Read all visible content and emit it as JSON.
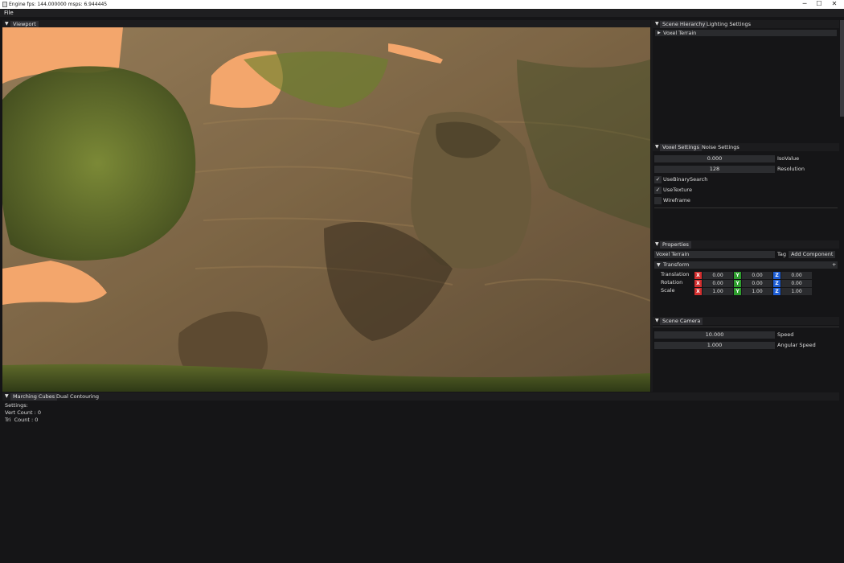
{
  "window": {
    "title": "Engine fps: 144.000000   msps: 6.944445"
  },
  "menubar": {
    "file": "File"
  },
  "viewport": {
    "tab": "Viewport"
  },
  "scene_hierarchy": {
    "tabs": [
      "Scene Hierarchy",
      "Lighting Settings"
    ],
    "items": [
      "Voxel Terrain"
    ]
  },
  "voxel_settings": {
    "tabs": [
      "Voxel Settings",
      "Noise Settings"
    ],
    "isovalue": {
      "value": "0.000",
      "label": "IsoValue"
    },
    "resolution": {
      "value": "128",
      "label": "Resolution"
    },
    "checkboxes": [
      {
        "label": "UseBinarySearch",
        "checked": true
      },
      {
        "label": "UseTexture",
        "checked": true
      },
      {
        "label": "Wireframe",
        "checked": false
      }
    ]
  },
  "properties": {
    "tab": "Properties",
    "name": "Voxel Terrain",
    "tag_label": "Tag",
    "add_component": "Add Component",
    "transform_header": "Transform",
    "transform_plus": "+",
    "rows": [
      {
        "label": "Translation",
        "x": "0.00",
        "y": "0.00",
        "z": "0.00"
      },
      {
        "label": "Rotation",
        "x": "0.00",
        "y": "0.00",
        "z": "0.00"
      },
      {
        "label": "Scale",
        "x": "1.00",
        "y": "1.00",
        "z": "1.00"
      }
    ],
    "axis_letters": {
      "x": "X",
      "y": "Y",
      "z": "Z"
    }
  },
  "scene_camera": {
    "tab": "Scene Camera",
    "speed": {
      "value": "10.000",
      "label": "Speed"
    },
    "angular_speed": {
      "value": "1.000",
      "label": "Angular Speed"
    }
  },
  "bottom_panel": {
    "tabs": [
      "Marching Cubes",
      "Dual Contouring"
    ],
    "lines": [
      "Settings:",
      "Vert Count : 0",
      "Tri  Count : 0"
    ]
  },
  "colors": {
    "axis_x": "#d32f2f",
    "axis_y": "#2e9e2e",
    "axis_z": "#1f5fd6",
    "sky": "#f3a66c"
  }
}
